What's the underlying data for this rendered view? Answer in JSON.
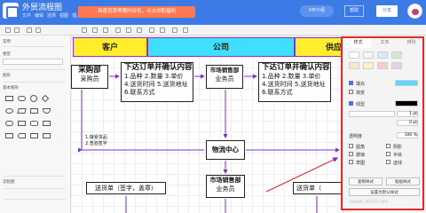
{
  "app": {
    "title": "外贸流程图",
    "menus": [
      "文件",
      "编辑",
      "选择",
      "视图",
      "插入",
      "帮助"
    ]
  },
  "header": {
    "notice": "恭喜您获得限时折扣，点击领取福利",
    "vip": "VIP介绍",
    "help": "帮助",
    "share": "分享"
  },
  "left_panel": {
    "section1": "常用",
    "section2": "便签",
    "section3": "图形",
    "section4": "基本图形",
    "section5": "流程图"
  },
  "canvas": {
    "lanes": [
      "客户",
      "公司",
      "供应"
    ],
    "lane_colors": [
      "#ffee2b",
      "#3fe0ff",
      "#ffee2b"
    ],
    "purchase_title": "采购部",
    "purchase_role": "采购员",
    "order_title_1": "下达订单并确认内容",
    "order_lines_1": [
      "1.品种 2.数量 3.单价",
      "4.送货时间 5.送货地址",
      "6.联系方式"
    ],
    "sales_title": "市场销售部",
    "sales_role": "业务员",
    "order_title_2": "下达订单并确认内容",
    "order_lines_2": [
      "1.品种 2.数量 3.单价",
      "4.送货时间 5.送货地址",
      "6.联系方式"
    ],
    "receive_lines": [
      "1.接受货品",
      "2.查验签字"
    ],
    "center": "物流中心",
    "sales2_title": "市场销售部",
    "sales2_role": "业务员",
    "delivery_left": "送货单（签字，盖章）",
    "delivery_right": "送货单（"
  },
  "right_panel": {
    "tabs": [
      "样式",
      "文本",
      "排列"
    ],
    "swatch_colors": [
      "#ffffff",
      "#f5f5f5",
      "#dae8fc",
      "#d5e8d4",
      "#ffe6cc",
      "#fff2cc",
      "#f8cecc",
      "#e1d5e7"
    ],
    "fill_label": "填充",
    "fill_color": "#5fd7ff",
    "gradient_label": "渐变",
    "line_label": "线型",
    "line_width": "1 pt",
    "perimeter": "0 pt",
    "opacity_label": "透明度",
    "opacity_value": "100 %",
    "options": [
      "圆角",
      "阴影",
      "玻璃",
      "手绘",
      "草图",
      "虚线"
    ],
    "btn_copy": "复制样式",
    "btn_paste": "粘贴样式",
    "btn_default": "设置为默认样式"
  },
  "watermark": "www.3000.net"
}
